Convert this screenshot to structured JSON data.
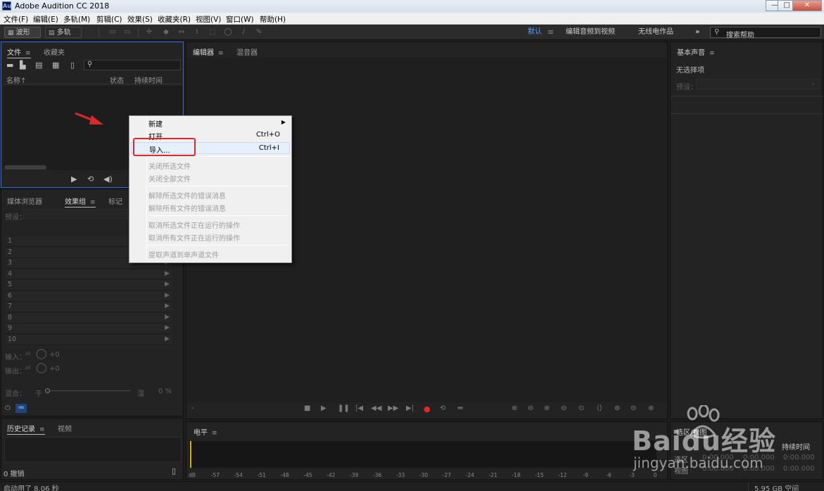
{
  "window": {
    "title": "Adobe Audition CC 2018",
    "app_icon_text": "Au",
    "controls": [
      "minimize-icon",
      "maximize-icon",
      "close-icon"
    ]
  },
  "menubar": [
    "文件(F)",
    "编辑(E)",
    "多轨(M)",
    "剪辑(C)",
    "效果(S)",
    "收藏夹(R)",
    "视图(V)",
    "窗口(W)",
    "帮助(H)"
  ],
  "toolbar": {
    "waveform_label": "波形",
    "multitrack_label": "多轨",
    "workspaces": [
      "默认",
      "编辑音频到视频",
      "无线电作品"
    ],
    "more": "»",
    "search_placeholder": "搜索帮助"
  },
  "files_panel": {
    "tabs": [
      "文件",
      "收藏夹"
    ],
    "columns": [
      "名称",
      "状态",
      "持续时间"
    ],
    "sort_indicator": "↑"
  },
  "effects_panel": {
    "tabs": [
      "媒体浏览器",
      "效果组",
      "标记"
    ],
    "preset_label": "预设：",
    "rack_slots": [
      "1",
      "2",
      "3",
      "4",
      "5",
      "6",
      "7",
      "8",
      "9",
      "10"
    ],
    "input_label": "输入：",
    "output_label": "输出：",
    "input_value": "+0",
    "output_value": "+0",
    "mix_label": "混合：",
    "mix_dry": "干",
    "mix_wet": "湿",
    "mix_value": "0 %"
  },
  "history_panel": {
    "tabs": [
      "历史记录",
      "视频"
    ],
    "undo_count": "0 撤销"
  },
  "editor_panel": {
    "tabs": [
      "编辑器",
      "混音器"
    ],
    "time_dash": "-"
  },
  "essential_sound_panel": {
    "title": "基本声音",
    "no_selection": "无选择项",
    "preset_label": "预设："
  },
  "levels_panel": {
    "title": "电平",
    "ticks": [
      "dB",
      "-57",
      "-54",
      "-51",
      "-48",
      "-45",
      "-42",
      "-39",
      "-36",
      "-33",
      "-30",
      "-27",
      "-24",
      "-21",
      "-18",
      "-15",
      "-12",
      "-9",
      "-6",
      "-3",
      "0"
    ]
  },
  "selection_view_panel": {
    "title": "选区/视图",
    "col_duration": "持续时间",
    "rows": [
      {
        "label": "选区",
        "start": "0:00.000",
        "end": "0:00.000",
        "duration": "0:00.000"
      },
      {
        "label": "视图",
        "start": "0:00.000",
        "end": "0:00.000",
        "duration": "0:00.000"
      }
    ]
  },
  "status": {
    "startup": "启动用了 8.06 秒",
    "disk_space": "5.95 GB 空间"
  },
  "context_menu": {
    "items": [
      {
        "label": "新建",
        "shortcut": "",
        "submenu": true,
        "enabled": true
      },
      {
        "label": "打开...",
        "shortcut": "Ctrl+O",
        "enabled": true
      },
      {
        "label": "导入...",
        "shortcut": "Ctrl+I",
        "enabled": true,
        "highlighted": true
      },
      {
        "label": "关闭所选文件",
        "shortcut": "",
        "enabled": false
      },
      {
        "label": "关闭全部文件",
        "shortcut": "",
        "enabled": false
      },
      {
        "label": "解除所选文件的错误消息",
        "shortcut": "",
        "enabled": false
      },
      {
        "label": "解除所有文件的错误消息",
        "shortcut": "",
        "enabled": false
      },
      {
        "label": "取消所选文件正在运行的操作",
        "shortcut": "",
        "enabled": false
      },
      {
        "label": "取消所有文件正在运行的操作",
        "shortcut": "",
        "enabled": false
      },
      {
        "label": "提取声道到单声道文件",
        "shortcut": "",
        "enabled": false
      }
    ]
  },
  "watermark": {
    "brand": "Baidu经验",
    "url": "jingyan.baidu.com"
  },
  "colors": {
    "panel_bg": "#232323",
    "accent_blue": "#2d6fd6",
    "record_red": "#e8262a",
    "annotation_red": "#e02828"
  }
}
